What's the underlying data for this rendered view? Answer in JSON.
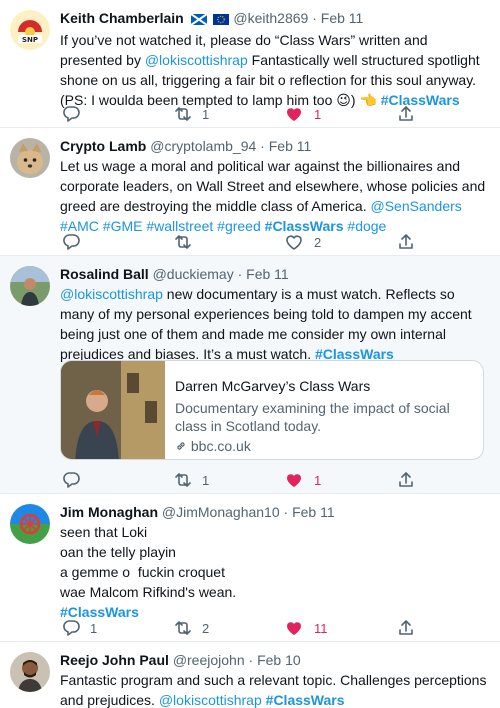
{
  "tweets": [
    {
      "name": "Keith Chamberlain",
      "handle": "@keith2869",
      "date": "Feb 11",
      "avatar_label": "SNP",
      "text_1": "If you’ve not watched it, please do “Class Wars” written and presented by ",
      "mention": "@lokiscottishrap",
      "text_2": " Fantastically well structured spotlight shone on us all, triggering a fair bit o reflection for this soul anyway. (PS: I woulda been tempted to lamp him too ",
      "emoji_1": "😉",
      "emoji_2": "👈",
      "hashtag": "#ClassWars",
      "retweets": "1",
      "likes": "1"
    },
    {
      "name": "Crypto Lamb",
      "handle": "@cryptolamb_94",
      "date": "Feb 11",
      "text": "Let us wage a moral and political war against the billionaires and corporate leaders, on Wall Street and elsewhere, whose policies and greed are destroying the middle class of America.",
      "tags": "@SenSanders #AMC #GME #wallstreet #greed",
      "hashtag": "#ClassWars",
      "tag_end": "#doge",
      "likes": "2"
    },
    {
      "name": "Rosalind Ball",
      "handle": "@duckiemay",
      "date": "Feb 11",
      "mention": "@lokiscottishrap",
      "text": " new documentary is a must watch. Reflects so many of my personal experiences being told to dampen my accent being just one of them and made me consider my own internal prejudices and biases. It’s a must watch. ",
      "hashtag": "#ClassWars",
      "card": {
        "title": "Darren McGarvey’s Class Wars",
        "description": "Documentary examining the impact of social class in Scotland today.",
        "domain": "bbc.co.uk"
      },
      "retweets": "1",
      "likes": "1"
    },
    {
      "name": "Jim Monaghan",
      "handle": "@JimMonaghan10",
      "date": "Feb 11",
      "lines": [
        "seen that Loki",
        "oan the telly playin",
        "a gemme o  fuckin croquet",
        "wae Malcom Rifkind's wean."
      ],
      "hashtag": "#ClassWars",
      "replies": "1",
      "retweets": "2",
      "likes": "11"
    },
    {
      "name": "Reejo John Paul",
      "handle": "@reejojohn",
      "date": "Feb 10",
      "text": "Fantastic program and such a relevant topic. Challenges perceptions and prejudices. ",
      "mention": "@lokiscottishrap",
      "hashtag": "#ClassWars"
    }
  ],
  "separator": "·",
  "colors": {
    "link": "#1b95e0",
    "like_active": "#e0245e",
    "muted": "#536471",
    "highlight_bg": "#f5f8fa"
  },
  "icons": [
    "reply-icon",
    "retweet-icon",
    "like-icon",
    "share-icon",
    "link-icon",
    "scotland-flag-icon",
    "eu-flag-icon"
  ]
}
